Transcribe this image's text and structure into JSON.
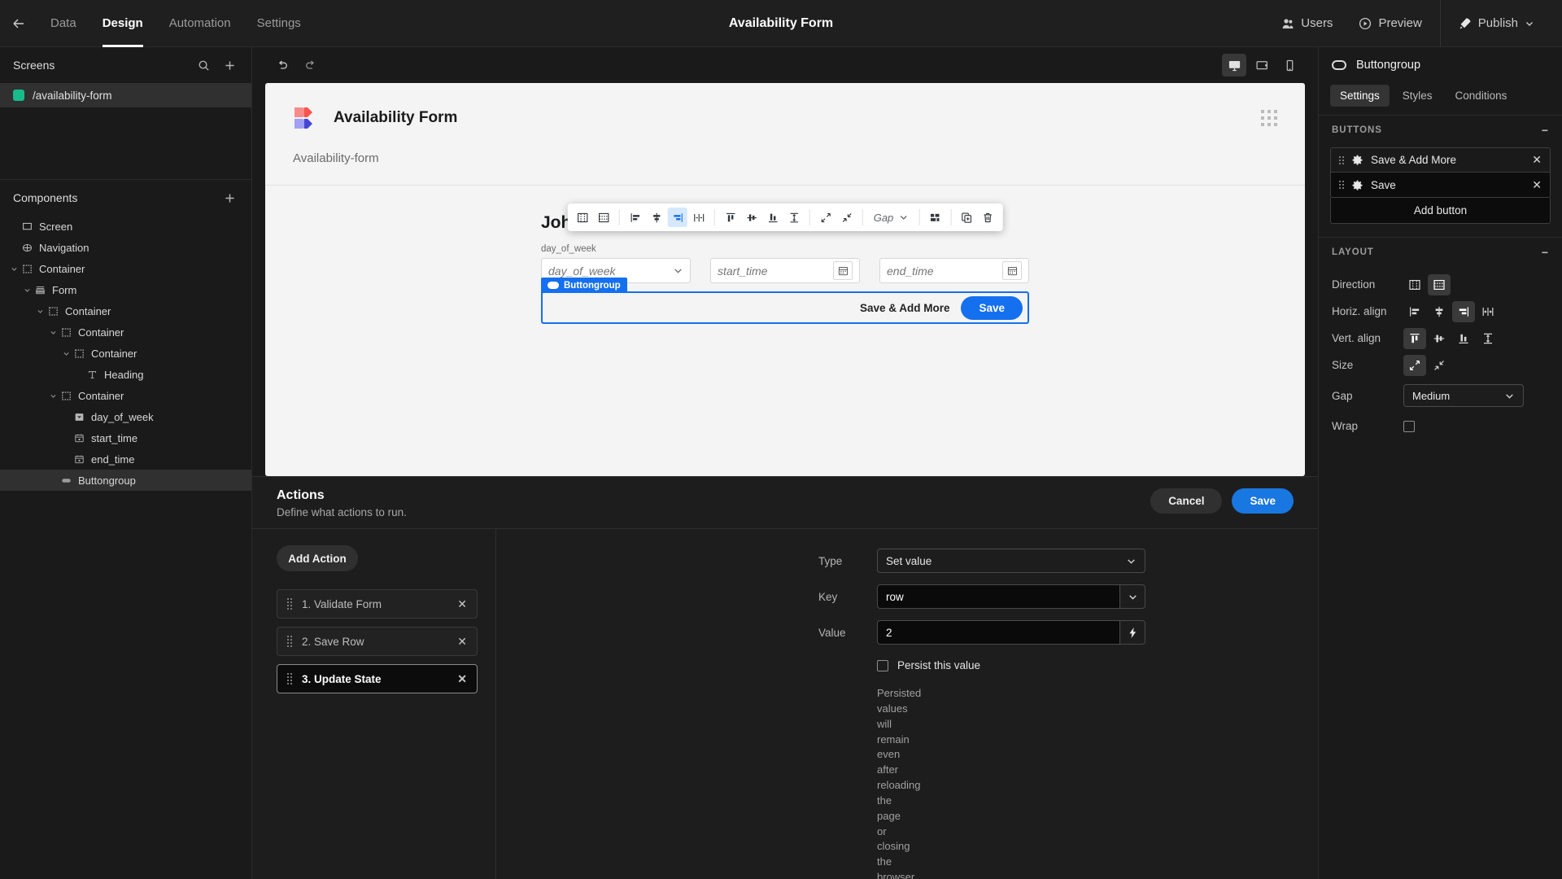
{
  "topbar": {
    "back_icon": "arrow-left-icon",
    "tabs": [
      {
        "label": "Data",
        "active": false
      },
      {
        "label": "Design",
        "active": true
      },
      {
        "label": "Automation",
        "active": false
      },
      {
        "label": "Settings",
        "active": false
      }
    ],
    "title": "Availability Form",
    "users_label": "Users",
    "preview_label": "Preview",
    "publish_label": "Publish"
  },
  "left": {
    "screens_title": "Screens",
    "search_icon": "search-icon",
    "add_icon": "plus-icon",
    "screens": [
      {
        "label": "/availability-form",
        "color": "#18bb8c",
        "selected": true
      }
    ],
    "components_title": "Components",
    "components_add_icon": "plus-icon",
    "tree": [
      {
        "label": "Screen",
        "depth": 0,
        "icon": "screen-icon",
        "caret": "none",
        "selected": false
      },
      {
        "label": "Navigation",
        "depth": 0,
        "icon": "navigation-icon",
        "caret": "none",
        "selected": false
      },
      {
        "label": "Container",
        "depth": 0,
        "icon": "container-icon",
        "caret": "down",
        "selected": false
      },
      {
        "label": "Form",
        "depth": 1,
        "icon": "form-icon",
        "caret": "down",
        "selected": false
      },
      {
        "label": "Container",
        "depth": 2,
        "icon": "container-icon",
        "caret": "down",
        "selected": false
      },
      {
        "label": "Container",
        "depth": 3,
        "icon": "container-icon",
        "caret": "down",
        "selected": false
      },
      {
        "label": "Container",
        "depth": 4,
        "icon": "container-icon",
        "caret": "down",
        "selected": false
      },
      {
        "label": "Heading",
        "depth": 5,
        "icon": "heading-icon",
        "caret": "none",
        "selected": false
      },
      {
        "label": "Container",
        "depth": 3,
        "icon": "container-icon",
        "caret": "down",
        "selected": false
      },
      {
        "label": "day_of_week",
        "depth": 4,
        "icon": "select-icon",
        "caret": "none",
        "selected": false
      },
      {
        "label": "start_time",
        "depth": 4,
        "icon": "calendar-icon",
        "caret": "none",
        "selected": false
      },
      {
        "label": "end_time",
        "depth": 4,
        "icon": "calendar-icon",
        "caret": "none",
        "selected": false
      },
      {
        "label": "Buttongroup",
        "depth": 3,
        "icon": "buttongroup-icon",
        "caret": "none",
        "selected": true
      }
    ]
  },
  "canvas_toolbar": {
    "undo_icon": "undo-icon",
    "redo_icon": "redo-icon",
    "devices": [
      {
        "name": "desktop-icon",
        "active": true
      },
      {
        "name": "tablet-icon",
        "active": false
      },
      {
        "name": "mobile-icon",
        "active": false
      }
    ]
  },
  "canvas": {
    "brand_title": "Availability Form",
    "breadcrumb": "Availability-form",
    "grip_icon": "grip-dots-icon",
    "form": {
      "heading": "John Doe: Week 8",
      "fields": [
        {
          "label": "day_of_week",
          "placeholder": "day_of_week",
          "kind": "select"
        },
        {
          "label": "",
          "placeholder": "start_time",
          "kind": "date"
        },
        {
          "label": "",
          "placeholder": "end_time",
          "kind": "date"
        }
      ],
      "selection_tag": "Buttongroup",
      "secondary_button": "Save & Add More",
      "primary_button": "Save"
    },
    "float_toolbar": {
      "gap_label": "Gap",
      "buttons": [
        {
          "name": "direction-horizontal-icon",
          "active": false
        },
        {
          "name": "direction-vertical-icon",
          "active": false
        },
        {
          "name": "align-left-icon",
          "active": false
        },
        {
          "name": "align-center-icon",
          "active": false
        },
        {
          "name": "align-right-icon",
          "active": true
        },
        {
          "name": "align-stretch-icon",
          "active": false
        },
        {
          "name": "valign-top-icon",
          "active": false
        },
        {
          "name": "valign-middle-icon",
          "active": false
        },
        {
          "name": "valign-bottom-icon",
          "active": false
        },
        {
          "name": "valign-stretch-icon",
          "active": false
        },
        {
          "name": "size-shrink-icon",
          "active": false
        },
        {
          "name": "size-grow-icon",
          "active": false
        },
        {
          "name": "layout-grid-icon",
          "active": false
        },
        {
          "name": "duplicate-icon",
          "active": false
        },
        {
          "name": "delete-icon",
          "active": false
        }
      ]
    }
  },
  "actions": {
    "title": "Actions",
    "description": "Define what actions to run.",
    "cancel_label": "Cancel",
    "save_label": "Save",
    "add_action_label": "Add Action",
    "list": [
      {
        "label": "1. Validate Form",
        "selected": false
      },
      {
        "label": "2. Save Row",
        "selected": false
      },
      {
        "label": "3. Update State",
        "selected": true
      }
    ],
    "detail": {
      "type_label": "Type",
      "type_value": "Set value",
      "key_label": "Key",
      "key_value": "row",
      "value_label": "Value",
      "value_value": "2",
      "persist_label": "Persist this value",
      "persist_checked": false,
      "help_text": "Persisted values will remain even after reloading the page or closing the browser."
    }
  },
  "right": {
    "component_icon": "buttongroup-icon",
    "component_name": "Buttongroup",
    "tabs": [
      {
        "label": "Settings",
        "active": true
      },
      {
        "label": "Styles",
        "active": false
      },
      {
        "label": "Conditions",
        "active": false
      }
    ],
    "buttons_section": {
      "title": "BUTTONS",
      "collapse_icon": "minus-icon",
      "items": [
        {
          "label": "Save & Add More",
          "dark": false
        },
        {
          "label": "Save",
          "dark": true
        }
      ],
      "add_label": "Add button"
    },
    "layout_section": {
      "title": "LAYOUT",
      "collapse_icon": "minus-icon",
      "direction_label": "Direction",
      "direction_options": [
        {
          "name": "direction-horizontal-icon",
          "active": false
        },
        {
          "name": "direction-vertical-icon",
          "active": true
        }
      ],
      "halign_label": "Horiz. align",
      "halign_options": [
        {
          "name": "align-left-icon",
          "active": false
        },
        {
          "name": "align-center-icon",
          "active": false
        },
        {
          "name": "align-right-icon",
          "active": true
        },
        {
          "name": "align-stretch-icon",
          "active": false
        }
      ],
      "valign_label": "Vert. align",
      "valign_options": [
        {
          "name": "valign-top-icon",
          "active": true
        },
        {
          "name": "valign-middle-icon",
          "active": false
        },
        {
          "name": "valign-bottom-icon",
          "active": false
        },
        {
          "name": "valign-stretch-icon",
          "active": false
        }
      ],
      "size_label": "Size",
      "size_options": [
        {
          "name": "size-shrink-icon",
          "active": true
        },
        {
          "name": "size-grow-icon",
          "active": false
        }
      ],
      "gap_label": "Gap",
      "gap_value": "Medium",
      "wrap_label": "Wrap",
      "wrap_checked": false
    }
  },
  "colors": {
    "accent_blue": "#1570ef",
    "screen_green": "#18bb8c",
    "panel_bg": "#1a1a1a",
    "canvas_bg": "#f4f4f5"
  }
}
